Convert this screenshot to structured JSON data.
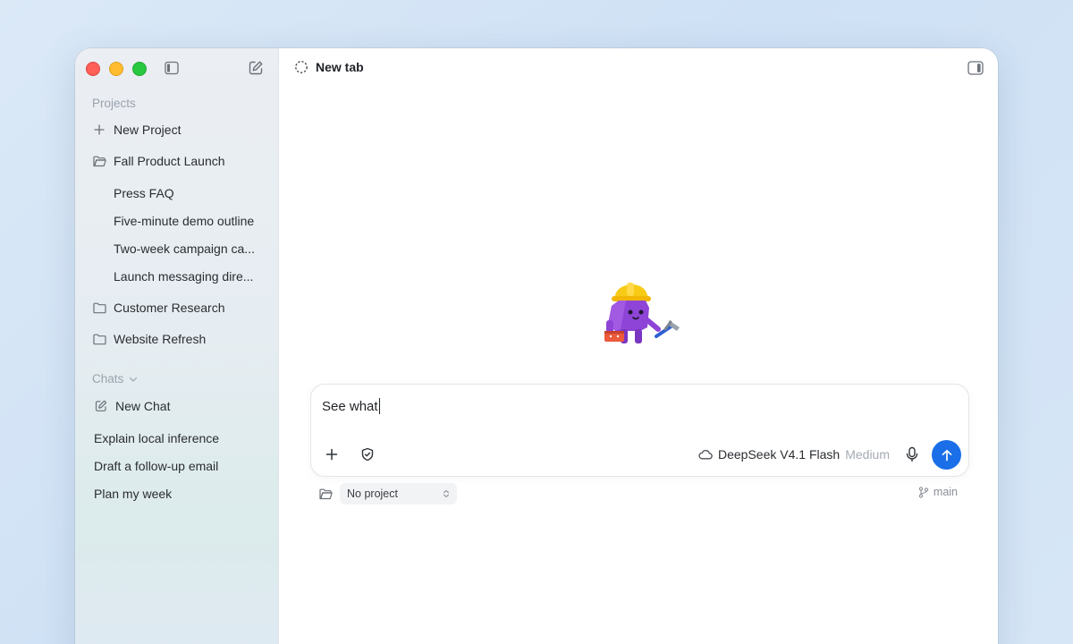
{
  "sidebar": {
    "projects_label": "Projects",
    "new_project": "New Project",
    "projects": [
      {
        "name": "Fall Product Launch",
        "threads": [
          "Press FAQ",
          "Five-minute demo outline",
          "Two-week campaign ca...",
          "Launch messaging dire..."
        ]
      },
      {
        "name": "Customer Research"
      },
      {
        "name": "Website Refresh"
      }
    ],
    "chats_label": "Chats",
    "new_chat": "New Chat",
    "chats": [
      "Explain local inference",
      "Draft a follow-up email",
      "Plan my week"
    ]
  },
  "main": {
    "tab_title": "New tab",
    "composer": {
      "value": "See what",
      "model_name": "DeepSeek V4.1 Flash",
      "model_effort": "Medium"
    },
    "project_select": "No project",
    "branch": "main"
  },
  "colors": {
    "accent": "#1a6fe8",
    "close": "#fe5f57",
    "minimize": "#febc2e",
    "zoom": "#28c840"
  },
  "icons": [
    "sidebar-toggle-icon",
    "compose-icon",
    "plus-icon",
    "folder-icon",
    "edit-icon",
    "chevron-down-icon",
    "dashed-circle-icon",
    "panel-icon",
    "shield-icon",
    "cloud-icon",
    "microphone-icon",
    "arrow-up-icon",
    "branch-icon",
    "updown-chevron-icon"
  ]
}
